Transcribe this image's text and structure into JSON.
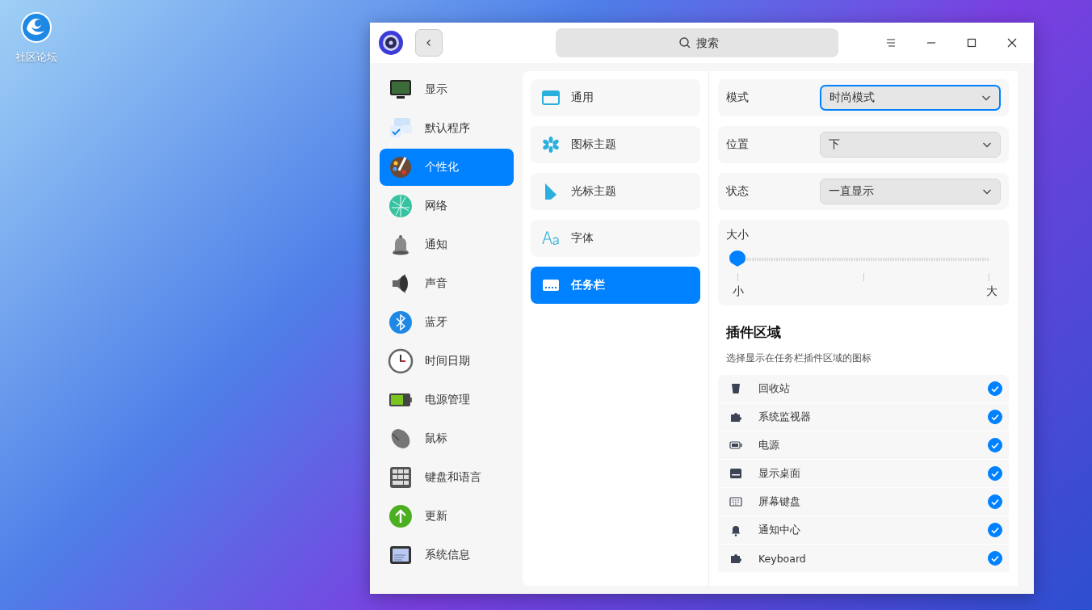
{
  "desktop": {
    "icons": [
      {
        "label": "社区论坛"
      }
    ]
  },
  "window": {
    "search": {
      "placeholder": "搜索"
    }
  },
  "sidebar": {
    "items": [
      {
        "label": "显示",
        "selected": false
      },
      {
        "label": "默认程序",
        "selected": false
      },
      {
        "label": "个性化",
        "selected": true
      },
      {
        "label": "网络",
        "selected": false
      },
      {
        "label": "通知",
        "selected": false
      },
      {
        "label": "声音",
        "selected": false
      },
      {
        "label": "蓝牙",
        "selected": false
      },
      {
        "label": "时间日期",
        "selected": false
      },
      {
        "label": "电源管理",
        "selected": false
      },
      {
        "label": "鼠标",
        "selected": false
      },
      {
        "label": "键盘和语言",
        "selected": false
      },
      {
        "label": "更新",
        "selected": false
      },
      {
        "label": "系统信息",
        "selected": false
      }
    ]
  },
  "categories": [
    {
      "label": "通用",
      "selected": false
    },
    {
      "label": "图标主题",
      "selected": false
    },
    {
      "label": "光标主题",
      "selected": false
    },
    {
      "label": "字体",
      "selected": false
    },
    {
      "label": "任务栏",
      "selected": true
    }
  ],
  "settings": {
    "dropdowns": [
      {
        "label": "模式",
        "value": "时尚模式",
        "focused": true
      },
      {
        "label": "位置",
        "value": "下",
        "focused": false
      },
      {
        "label": "状态",
        "value": "一直显示",
        "focused": false
      }
    ],
    "size": {
      "label": "大小",
      "level": 0,
      "min_label": "小",
      "max_label": "大"
    }
  },
  "plugins": {
    "title": "插件区域",
    "description": "选择显示在任务栏插件区域的图标",
    "items": [
      {
        "label": "回收站",
        "checked": true
      },
      {
        "label": "系统监视器",
        "checked": true
      },
      {
        "label": "电源",
        "checked": true
      },
      {
        "label": "显示桌面",
        "checked": true
      },
      {
        "label": "屏幕键盘",
        "checked": true
      },
      {
        "label": "通知中心",
        "checked": true
      },
      {
        "label": "Keyboard",
        "checked": true
      }
    ]
  }
}
